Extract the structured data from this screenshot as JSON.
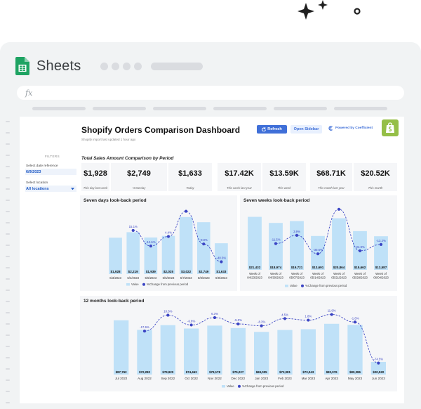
{
  "app": {
    "name": "Sheets"
  },
  "formula_bar": {
    "symbol": "fx"
  },
  "dashboard": {
    "title": "Shopify Orders Comparison Dashboard",
    "subtitle": "Shopify import last updated 1 hour ago",
    "refresh_label": "Refresh",
    "open_sidebar_label": "Open Sidebar",
    "powered_by": "Powered by Coefficient"
  },
  "filters": {
    "heading": "FILTERS",
    "date_caption": "Select date reference",
    "date_value": "6/9/2023",
    "location_caption": "Select location",
    "location_value": "All locations"
  },
  "kpi_section": {
    "title": "Total Sales Amount Comparison by Period",
    "cards": [
      {
        "value": "$1,928",
        "label": "This day last week"
      },
      {
        "value": "$2,749",
        "label": "Yesterday"
      },
      {
        "value": "$1,633",
        "label": "Today"
      },
      {
        "value": "$17.42K",
        "label": "This week last year"
      },
      {
        "value": "$13.59K",
        "label": "This week"
      },
      {
        "value": "$68.71K",
        "label": "This month last year"
      },
      {
        "value": "$20.52K",
        "label": "This month"
      }
    ]
  },
  "legend": {
    "value_label": "Value",
    "pct_label": "%Change from previous period"
  },
  "colors": {
    "bar": "#bfe1f8",
    "line": "#3b45c4",
    "accent": "#3f6fd8",
    "shopify": "#95bf47"
  },
  "chart_data": [
    {
      "type": "bar",
      "title": "Seven days look-back period",
      "categories": [
        "6/3/2023",
        "6/4/2023",
        "6/5/2023",
        "6/6/2023",
        "6/7/2023",
        "6/8/2023",
        "6/9/2023"
      ],
      "series": [
        {
          "name": "Value",
          "values": [
            1928,
            2219,
            1939,
            2025,
            3022,
            2749,
            1633
          ],
          "labels": [
            "$1,928",
            "$2,219",
            "$1,939",
            "$2,025",
            "$3,022",
            "$2,749",
            "$1,633"
          ]
        },
        {
          "name": "%Change from previous period",
          "values": [
            null,
            15.1,
            -12.6,
            4.4,
            49.2,
            -9.0,
            -40.6
          ],
          "labels": [
            "",
            "15.1%",
            "-12.6%",
            "4.4%",
            "",
            "-9.0%",
            "-40.6%"
          ]
        }
      ],
      "ylim": [
        0,
        3500
      ],
      "pct_lim": [
        -50,
        60
      ]
    },
    {
      "type": "bar",
      "title": "Seven weeks look-back period",
      "categories": [
        "Week of 04/23/2023",
        "Week of 04/30/2023",
        "Week of 05/07/2023",
        "Week of 05/14/2023",
        "Week of 05/21/2023",
        "Week of 05/28/2023",
        "Week of 06/04/2023"
      ],
      "series": [
        {
          "name": "Value",
          "values": [
            21432,
            18974,
            19721,
            13691,
            20864,
            15662,
            13587
          ],
          "labels": [
            "$21,432",
            "$18,974",
            "$19,721",
            "$13,691",
            "$20,864",
            "$15,662",
            "$13,587"
          ]
        },
        {
          "name": "%Change from previous period",
          "values": [
            null,
            -11.5,
            3.9,
            -30.6,
            52.4,
            -24.9,
            -13.2
          ],
          "labels": [
            "",
            "-11.5%",
            "3.9%",
            "-30.6%",
            "",
            "-24.9%",
            "-13.2%"
          ]
        }
      ],
      "ylim": [
        0,
        25000
      ],
      "pct_lim": [
        -50,
        60
      ]
    },
    {
      "type": "bar",
      "title": "12 months look-back period",
      "categories": [
        "Jul 2022",
        "Aug 2022",
        "Sep 2022",
        "Oct 2022",
        "Nov 2022",
        "Dec 2022",
        "Jan 2023",
        "Feb 2023",
        "Mar 2023",
        "Apr 2023",
        "May 2023",
        "Jun 2023"
      ],
      "series": [
        {
          "name": "Value",
          "values": [
            87762,
            72290,
            79920,
            74463,
            79178,
            75227,
            69005,
            72081,
            73343,
            82076,
            80386,
            20520
          ],
          "labels": [
            "$87,762",
            "$72,290",
            "$79,920",
            "$74,463",
            "$79,178",
            "$75,227",
            "$69,005",
            "$72,081",
            "$73,343",
            "$82,076",
            "$80,386",
            "$20,520"
          ]
        },
        {
          "name": "%Change from previous period",
          "values": [
            null,
            -17.6,
            10.6,
            -6.8,
            6.3,
            -5.0,
            -8.3,
            4.5,
            1.8,
            11.9,
            -1.6,
            -74.5
          ],
          "labels": [
            "",
            "-17.6%",
            "10.6%",
            "-6.8%",
            "6.3%",
            "-5.0%",
            "-8.3%",
            "4.5%",
            "1.8%",
            "11.9%",
            "-1.6%",
            "-74.5%"
          ]
        }
      ],
      "ylim": [
        0,
        100000
      ],
      "pct_lim": [
        -80,
        20
      ]
    }
  ]
}
